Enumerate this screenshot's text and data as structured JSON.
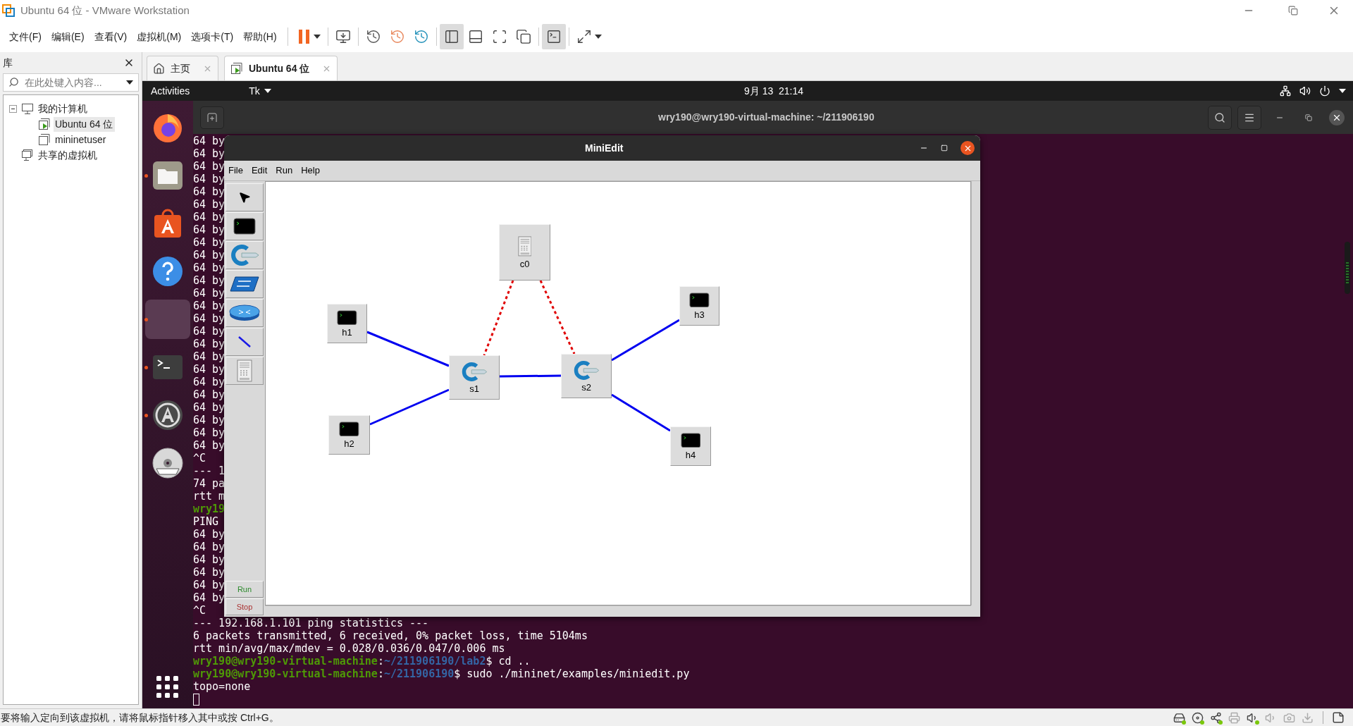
{
  "window": {
    "title": "Ubuntu 64 位 - VMware Workstation"
  },
  "menu": [
    "文件(F)",
    "编辑(E)",
    "查看(V)",
    "虚拟机(M)",
    "选项卡(T)",
    "帮助(H)"
  ],
  "toolbar": [
    {
      "kind": "pause",
      "pressed": false
    },
    {
      "kind": "send-keys",
      "pressed": false
    },
    {
      "kind": "snapshot-take",
      "pressed": false
    },
    {
      "kind": "snapshot-revert",
      "pressed": false
    },
    {
      "kind": "snapshot-manage",
      "pressed": false
    },
    {
      "kind": "view-library",
      "pressed": true
    },
    {
      "kind": "view-thumbnails",
      "pressed": false
    },
    {
      "kind": "view-fit",
      "pressed": false
    },
    {
      "kind": "view-autosize",
      "pressed": false
    },
    {
      "kind": "console",
      "pressed": true
    },
    {
      "kind": "fullscreen",
      "pressed": false
    }
  ],
  "library": {
    "title": "库",
    "search": {
      "placeholder": "在此处键入内容..."
    },
    "tree": [
      {
        "label": "我的计算机",
        "kind": "computer",
        "expanded": true,
        "selected": false,
        "children": [
          {
            "label": "Ubuntu 64 位",
            "kind": "vm-running",
            "selected": true
          },
          {
            "label": "mininetuser",
            "kind": "vm",
            "selected": false
          }
        ]
      },
      {
        "label": "共享的虚拟机",
        "kind": "shared",
        "selected": false
      }
    ]
  },
  "tabs": [
    {
      "label": "主页",
      "kind": "home",
      "selected": false
    },
    {
      "label": "Ubuntu 64 位",
      "kind": "vm",
      "selected": true
    }
  ],
  "top_bar": {
    "activities": "Activities",
    "app_menu": "Tk",
    "clock": "9月 13  21:14"
  },
  "dock": [
    {
      "kind": "firefox",
      "running": false,
      "selected": false
    },
    {
      "kind": "files",
      "running": true,
      "selected": false
    },
    {
      "kind": "software",
      "running": false,
      "selected": false
    },
    {
      "kind": "help",
      "running": false,
      "selected": false
    },
    {
      "kind": "blank",
      "running": true,
      "selected": true
    },
    {
      "kind": "terminal",
      "running": true,
      "selected": false
    },
    {
      "kind": "updater",
      "running": true,
      "selected": false
    },
    {
      "kind": "dvd",
      "running": false,
      "selected": false
    }
  ],
  "terminal": {
    "title": "wry190@wry190-virtual-machine: ~/211906190",
    "lines": [
      {
        "kind": "output",
        "text": "64 by"
      },
      {
        "kind": "output",
        "text": "64 by"
      },
      {
        "kind": "output",
        "text": "64 by"
      },
      {
        "kind": "output",
        "text": "64 by"
      },
      {
        "kind": "output",
        "text": "64 by"
      },
      {
        "kind": "output",
        "text": "64 by"
      },
      {
        "kind": "output",
        "text": "64 by"
      },
      {
        "kind": "output",
        "text": "64 by"
      },
      {
        "kind": "output",
        "text": "64 by"
      },
      {
        "kind": "output",
        "text": "64 by"
      },
      {
        "kind": "output",
        "text": "64 by"
      },
      {
        "kind": "output",
        "text": "64 by"
      },
      {
        "kind": "output",
        "text": "64 by"
      },
      {
        "kind": "output",
        "text": "64 by"
      },
      {
        "kind": "output",
        "text": "64 by"
      },
      {
        "kind": "output",
        "text": "64 by"
      },
      {
        "kind": "output",
        "text": "64 by"
      },
      {
        "kind": "output",
        "text": "64 by"
      },
      {
        "kind": "output",
        "text": "64 by"
      },
      {
        "kind": "output",
        "text": "64 by"
      },
      {
        "kind": "output",
        "text": "64 by"
      },
      {
        "kind": "output",
        "text": "64 by"
      },
      {
        "kind": "output",
        "text": "64 by"
      },
      {
        "kind": "output",
        "text": "64 by"
      },
      {
        "kind": "output",
        "text": "64 by"
      },
      {
        "kind": "output",
        "text": "^C"
      },
      {
        "kind": "output",
        "text": "--- 1"
      },
      {
        "kind": "output",
        "text": "74 pa"
      },
      {
        "kind": "output",
        "text": "rtt m"
      },
      {
        "kind": "prompt",
        "segments": [
          {
            "kind": "user",
            "text": "wry19"
          }
        ]
      },
      {
        "kind": "output",
        "text": "PING"
      },
      {
        "kind": "output",
        "text": "64 by"
      },
      {
        "kind": "output",
        "text": "64 by"
      },
      {
        "kind": "output",
        "text": "64 by"
      },
      {
        "kind": "output",
        "text": "64 by"
      },
      {
        "kind": "output",
        "text": "64 by"
      },
      {
        "kind": "output",
        "text": "64 by"
      },
      {
        "kind": "output",
        "text": "^C"
      },
      {
        "kind": "output",
        "text": "--- 192.168.1.101 ping statistics ---"
      },
      {
        "kind": "output",
        "text": "6 packets transmitted, 6 received, 0% packet loss, time 5104ms"
      },
      {
        "kind": "output",
        "text": "rtt min/avg/max/mdev = 0.028/0.036/0.047/0.006 ms"
      },
      {
        "kind": "prompt",
        "segments": [
          {
            "kind": "user",
            "text": "wry190@wry190-virtual-machine"
          },
          {
            "kind": "plain",
            "text": ":"
          },
          {
            "kind": "path",
            "text": "~/211906190/lab2"
          },
          {
            "kind": "plain",
            "text": "$ cd .."
          }
        ]
      },
      {
        "kind": "prompt",
        "segments": [
          {
            "kind": "user",
            "text": "wry190@wry190-virtual-machine"
          },
          {
            "kind": "plain",
            "text": ":"
          },
          {
            "kind": "path",
            "text": "~/211906190"
          },
          {
            "kind": "plain",
            "text": "$ sudo ./mininet/examples/miniedit.py"
          }
        ]
      },
      {
        "kind": "output",
        "text": "topo=none"
      },
      {
        "kind": "cursor"
      }
    ]
  },
  "miniedit": {
    "title": "MiniEdit",
    "menu": [
      "File",
      "Edit",
      "Run",
      "Help"
    ],
    "tools": [
      {
        "kind": "select"
      },
      {
        "kind": "host"
      },
      {
        "kind": "switch"
      },
      {
        "kind": "legacy-switch"
      },
      {
        "kind": "legacy-router"
      },
      {
        "kind": "link"
      },
      {
        "kind": "controller"
      }
    ],
    "run_button": "Run",
    "stop_button": "Stop",
    "nodes": [
      {
        "label": "c0",
        "kind": "controller"
      },
      {
        "label": "h1",
        "kind": "host"
      },
      {
        "label": "h2",
        "kind": "host"
      },
      {
        "label": "s1",
        "kind": "switch"
      },
      {
        "label": "s2",
        "kind": "switch"
      },
      {
        "label": "h3",
        "kind": "host"
      },
      {
        "label": "h4",
        "kind": "host"
      }
    ],
    "links": [
      {
        "kind": "data"
      },
      {
        "kind": "data"
      },
      {
        "kind": "data"
      },
      {
        "kind": "data"
      },
      {
        "kind": "data"
      },
      {
        "kind": "control"
      },
      {
        "kind": "control"
      }
    ]
  },
  "status_bar": {
    "text": "要将输入定向到该虚拟机，请将鼠标指针移入其中或按 Ctrl+G。",
    "devices": [
      {
        "kind": "disk",
        "connected": true
      },
      {
        "kind": "cd",
        "connected": true
      },
      {
        "kind": "network",
        "connected": true
      },
      {
        "kind": "printer",
        "connected": false
      },
      {
        "kind": "sound",
        "connected": true
      },
      {
        "kind": "speaker",
        "connected": false
      },
      {
        "kind": "camera",
        "connected": false
      },
      {
        "kind": "usb",
        "connected": false
      }
    ]
  }
}
